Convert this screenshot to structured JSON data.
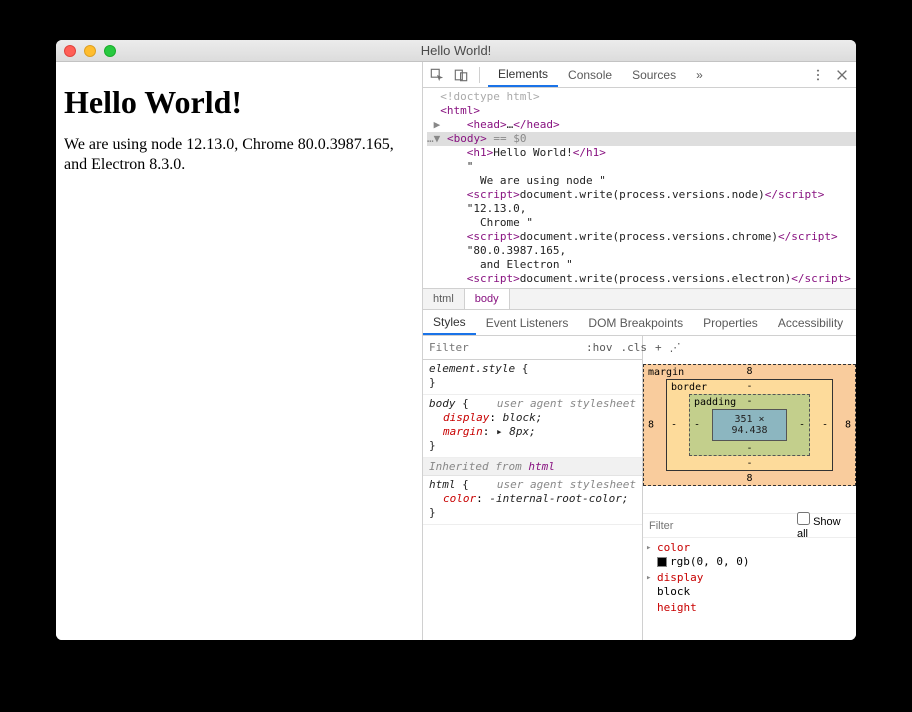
{
  "window": {
    "title": "Hello World!"
  },
  "page": {
    "heading": "Hello World!",
    "body_text": "We are using node 12.13.0, Chrome 80.0.3987.165, and Electron 8.3.0."
  },
  "devtools": {
    "tabs": [
      "Elements",
      "Console",
      "Sources"
    ],
    "active_tab": "Elements",
    "more_glyph": "»",
    "dom_lines": [
      {
        "indent": 1,
        "type": "doctype",
        "text": "<!doctype html>"
      },
      {
        "indent": 1,
        "type": "tag",
        "open": "<html>",
        "close": ""
      },
      {
        "indent": 2,
        "type": "collapsed",
        "tri": "▶",
        "open": "<head>",
        "ellipsis": "…",
        "close": "</head>"
      },
      {
        "indent": 1,
        "type": "selected",
        "gutter": "…▼",
        "open": "<body>",
        "suffix": " == $0"
      },
      {
        "indent": 3,
        "type": "element",
        "open": "<h1>",
        "text": "Hello World!",
        "close": "</h1>"
      },
      {
        "indent": 3,
        "type": "text",
        "text": "\""
      },
      {
        "indent": 4,
        "type": "text",
        "text": "We are using node \""
      },
      {
        "indent": 3,
        "type": "element",
        "open": "<script>",
        "text": "document.write(process.versions.node)",
        "close": "</script>"
      },
      {
        "indent": 3,
        "type": "text",
        "text": "\"12.13.0,"
      },
      {
        "indent": 4,
        "type": "text",
        "text": "Chrome \""
      },
      {
        "indent": 3,
        "type": "element",
        "open": "<script>",
        "text": "document.write(process.versions.chrome)",
        "close": "</script>"
      },
      {
        "indent": 3,
        "type": "text",
        "text": "\"80.0.3987.165,"
      },
      {
        "indent": 4,
        "type": "text",
        "text": "and Electron \""
      },
      {
        "indent": 3,
        "type": "element_cut",
        "open": "<script>",
        "text": "document.write(process.versions.electron)",
        "close": "</script>"
      }
    ],
    "crumbs": [
      "html",
      "body"
    ],
    "sub_tabs": [
      "Styles",
      "Event Listeners",
      "DOM Breakpoints",
      "Properties",
      "Accessibility"
    ],
    "active_sub": "Styles",
    "styles": {
      "filter_placeholder": "Filter",
      "hov": ":hov",
      "cls": ".cls",
      "rules": [
        {
          "selector": "element.style",
          "ua": "",
          "props": []
        },
        {
          "selector": "body",
          "ua": "user agent stylesheet",
          "props": [
            {
              "name": "display",
              "value": "block;"
            },
            {
              "name": "margin",
              "value": "▸ 8px;"
            }
          ]
        },
        {
          "inherited_from": "html"
        },
        {
          "selector": "html",
          "ua": "user agent stylesheet",
          "props": [
            {
              "name": "color",
              "value": "-internal-root-color;"
            }
          ]
        }
      ]
    },
    "boxmodel": {
      "margin": {
        "label": "margin",
        "top": "8",
        "right": "8",
        "bottom": "8",
        "left": "8"
      },
      "border": {
        "label": "border",
        "top": "-",
        "right": "-",
        "bottom": "-",
        "left": "-"
      },
      "padding": {
        "label": "padding",
        "top": "-",
        "right": "-",
        "bottom": "-",
        "left": "-"
      },
      "content": "351 × 94.438"
    },
    "computed": {
      "filter_placeholder": "Filter",
      "showall_label": "Show all",
      "items": [
        {
          "name": "color",
          "value": "rgb(0, 0, 0)",
          "swatch": true,
          "tri": true
        },
        {
          "name": "display",
          "value": "block",
          "tri": true
        },
        {
          "name": "height",
          "value": "",
          "dim": true
        }
      ]
    }
  }
}
